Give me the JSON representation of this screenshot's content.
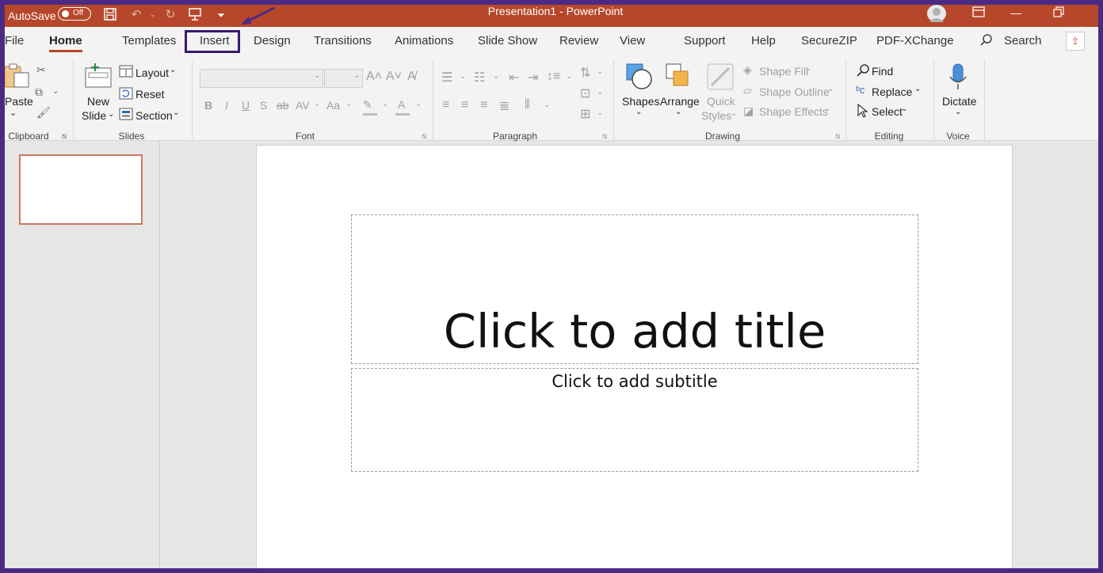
{
  "titlebar": {
    "autosave_label": "AutoSave",
    "toggle_state": "Off",
    "document_title": "Presentation1  -  PowerPoint"
  },
  "tabs": [
    "File",
    "Home",
    "Templates",
    "Insert",
    "Design",
    "Transitions",
    "Animations",
    "Slide Show",
    "Review",
    "View",
    "Support",
    "Help",
    "SecureZIP",
    "PDF-XChange"
  ],
  "search_label": "Search",
  "ribbon": {
    "clipboard": {
      "paste": "Paste",
      "group": "Clipboard"
    },
    "slides": {
      "new_slide_1": "New",
      "new_slide_2": "Slide",
      "layout": "Layout",
      "reset": "Reset",
      "section": "Section",
      "group": "Slides"
    },
    "font": {
      "bold": "B",
      "italic": "I",
      "underline": "U",
      "shadow": "S",
      "strike": "ab",
      "spacing": "AV",
      "case": "Aa",
      "color": "A",
      "group": "Font"
    },
    "paragraph": {
      "group": "Paragraph"
    },
    "drawing": {
      "shapes": "Shapes",
      "arrange": "Arrange",
      "quick_styles_1": "Quick",
      "quick_styles_2": "Styles",
      "shape_fill": "Shape Fill",
      "shape_outline": "Shape Outline",
      "shape_effects": "Shape Effects",
      "group": "Drawing"
    },
    "editing": {
      "find": "Find",
      "replace": "Replace",
      "select": "Select",
      "group": "Editing"
    },
    "voice": {
      "dictate": "Dictate",
      "group": "Voice"
    }
  },
  "slide": {
    "title_placeholder": "Click to add title",
    "subtitle_placeholder": "Click to add subtitle"
  },
  "colors": {
    "accent": "#b7472a",
    "highlight_box": "#3a1a6e"
  }
}
